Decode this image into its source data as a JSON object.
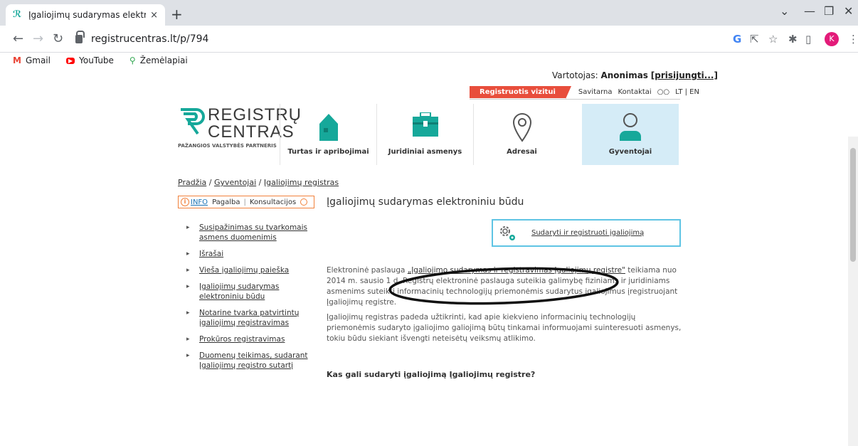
{
  "browser": {
    "tab_title": "Įgaliojimų sudarymas elektronini",
    "tab_close": "×",
    "new_tab": "+",
    "url": "registrucentras.lt/p/794",
    "avatar_letter": "K",
    "bookmarks": [
      {
        "label": "Gmail",
        "icon": "M"
      },
      {
        "label": "YouTube",
        "icon": "▶"
      },
      {
        "label": "Žemėlapiai",
        "icon": "⚲"
      }
    ]
  },
  "header": {
    "user_label": "Vartotojas:",
    "user_name": "Anonimas",
    "login_link": "[prisijungti...]",
    "register_button": "Registruotis vizitui",
    "links": [
      "Savitarna",
      "Kontaktai",
      "LT | EN"
    ],
    "logo_line1": "REGISTRŲ",
    "logo_line2": "CENTRAS",
    "logo_tagline": "PAŽANGIOS VALSTYBĖS PARTNERIS"
  },
  "categories": [
    {
      "label": "Turtas ir apribojimai",
      "icon": "house-icon"
    },
    {
      "label": "Juridiniai asmenys",
      "icon": "briefcase-icon"
    },
    {
      "label": "Adresai",
      "icon": "location-pin-icon"
    },
    {
      "label": "Gyventojai",
      "icon": "person-icon",
      "active": true
    }
  ],
  "breadcrumb": {
    "items": [
      "Pradžia",
      "Gyventojai",
      "Įgaliojimų registras"
    ],
    "separator": " / "
  },
  "infobox": {
    "info": "INFO",
    "help": "Pagalba",
    "sep": "|",
    "consult": "Konsultacijos"
  },
  "sidebar": {
    "items": [
      "Susipažinimas su tvarkomais asmens duomenimis",
      "Išrašai",
      "Vieša įgaliojimų paieška",
      "Įgaliojimų sudarymas elektroniniu būdu",
      "Notarine tvarka patvirtintų įgaliojimų registravimas",
      "Prokūros registravimas",
      "Duomenų teikimas, sudarant Įgaliojimų registro sutartį"
    ]
  },
  "main": {
    "title": "Įgaliojimų sudarymas elektroniniu būdu",
    "action_label": "Sudaryti ir registruoti įgaliojimą",
    "p1_before": "Elektroninė paslauga ",
    "p1_link": "„Įgaliojimo sudarymas ir registravimas Įgaliojimų registre\"",
    "p1_after": " teikiama nuo 2014 m. sausio 1 d. Registrų elektroninė paslauga suteikia galimybę fiziniams ir juridiniams asmenims suteikti informacinių technologijų priemonėmis sudarytus įgaliojimus įregistruojant Įgaliojimų registre.",
    "p2": "Įgaliojimų registras padeda užtikrinti, kad apie kiekvieno informacinių technologijų priemonėmis sudaryto įgaliojimo galiojimą būtų tinkamai informuojami suinteresuoti asmenys, tokiu būdu siekiant išvengti neteisėtų veiksmų atlikimo.",
    "h2": "Kas gali sudaryti įgaliojimą Įgaliojimų registre?"
  },
  "colors": {
    "accent_red": "#e84e3c",
    "accent_teal": "#16a89a",
    "active_tab_bg": "#d5ecf7",
    "action_border": "#5fc4e4",
    "info_orange": "#f1813b"
  }
}
